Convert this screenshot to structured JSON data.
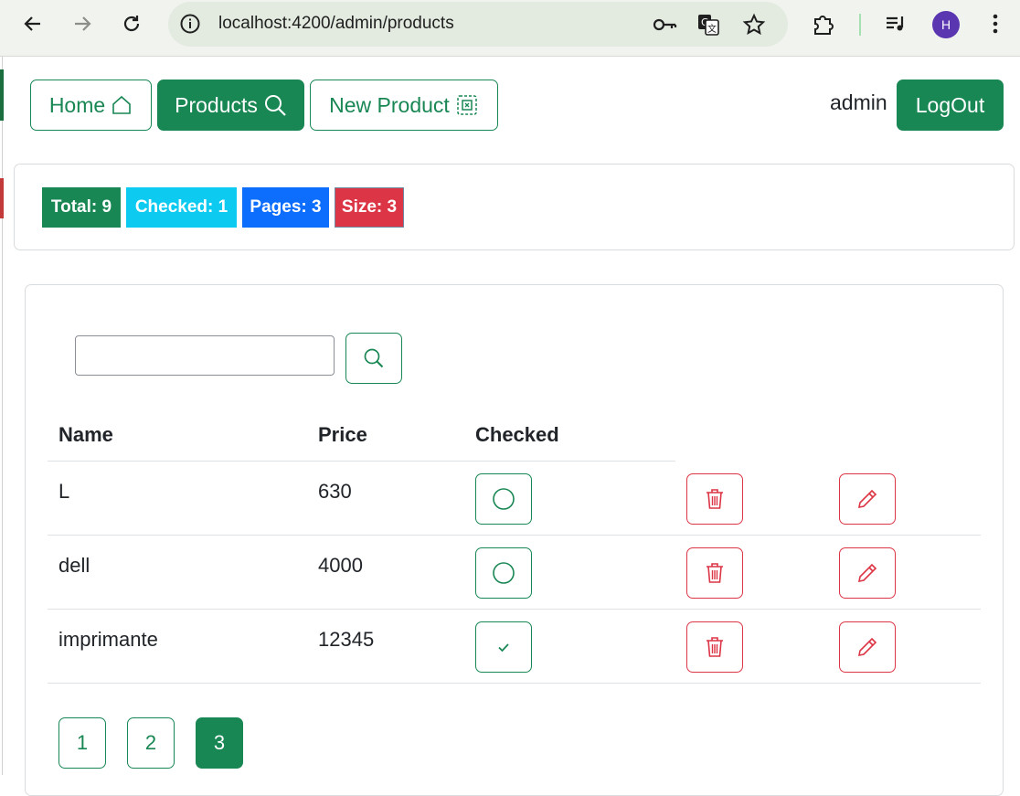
{
  "browser": {
    "url": "localhost:4200/admin/products",
    "profile_initial": "H"
  },
  "navbar": {
    "home_label": "Home",
    "products_label": "Products",
    "new_product_label": "New Product",
    "username": "admin",
    "logout_label": "LogOut"
  },
  "stats": {
    "total": "Total: 9",
    "checked": "Checked: 1",
    "pages": "Pages: 3",
    "size": "Size: 3"
  },
  "search": {
    "value": "",
    "placeholder": ""
  },
  "table": {
    "headers": [
      "Name",
      "Price",
      "Checked"
    ],
    "rows": [
      {
        "name": "L",
        "price": "630",
        "checked": false
      },
      {
        "name": "dell",
        "price": "4000",
        "checked": false
      },
      {
        "name": "imprimante",
        "price": "12345",
        "checked": true
      }
    ]
  },
  "pagination": {
    "pages": [
      "1",
      "2",
      "3"
    ],
    "current": "3"
  },
  "colors": {
    "success": "#198754",
    "info": "#0dcaf0",
    "primary": "#0d6efd",
    "danger": "#dc3545"
  }
}
